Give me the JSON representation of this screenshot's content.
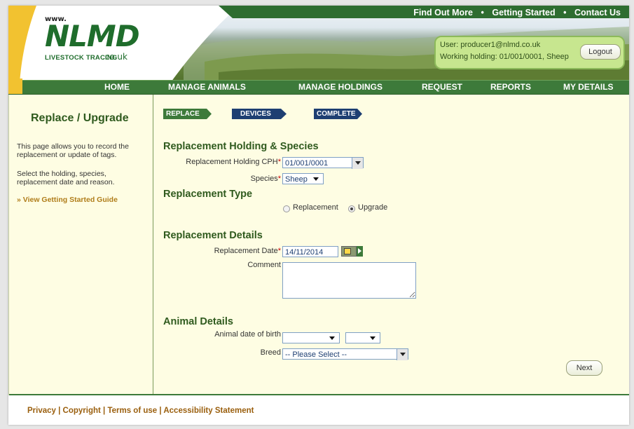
{
  "top_links": [
    "Find Out More",
    "Getting Started",
    "Contact Us"
  ],
  "logo": {
    "www": "www.",
    "name": "NLMD",
    "domain": ".co.uk",
    "tagline": "LIVESTOCK TRACING"
  },
  "user": {
    "user_line": "User: producer1@nlmd.co.uk",
    "holding_line": "Working holding: 01/001/0001, Sheep",
    "logout": "Logout"
  },
  "nav": [
    "HOME",
    "MANAGE ANIMALS",
    "MANAGE HOLDINGS",
    "REQUEST",
    "REPORTS",
    "MY DETAILS"
  ],
  "sidebar": {
    "title": "Replace / Upgrade",
    "p1": "This page allows you to record the replacement or update of tags.",
    "p2": "Select the holding, species, replacement date and reason.",
    "guide": "» View Getting Started Guide"
  },
  "steps": [
    {
      "label": "REPLACE",
      "state": "active"
    },
    {
      "label": "DEVICES",
      "state": "pending"
    },
    {
      "label": "COMPLETE",
      "state": "pending"
    }
  ],
  "form": {
    "sec_holding": "Replacement Holding & Species",
    "cph_label": "Replacement Holding CPH",
    "cph_value": "01/001/0001",
    "species_label": "Species",
    "species_value": "Sheep",
    "required_mark": "*",
    "sec_type": "Replacement Type",
    "type_options": [
      {
        "label": "Replacement",
        "checked": false
      },
      {
        "label": "Upgrade",
        "checked": true
      }
    ],
    "sec_details": "Replacement Details",
    "date_label": "Replacement Date",
    "date_value": "14/11/2014",
    "comment_label": "Comment",
    "comment_value": "",
    "sec_animal": "Animal Details",
    "dob_label": "Animal date of birth",
    "dob_month": "",
    "dob_year": "",
    "breed_label": "Breed",
    "breed_value": "-- Please Select --",
    "next": "Next"
  },
  "footer": "Privacy | Copyright | Terms of use | Accessibility Statement",
  "colors": {
    "nav_green": "#3d7a3a",
    "title_green": "#2f5a1e",
    "step_blue": "#1e3f72",
    "panel_bg": "#fefde3",
    "link_orange": "#9a5f0e"
  }
}
